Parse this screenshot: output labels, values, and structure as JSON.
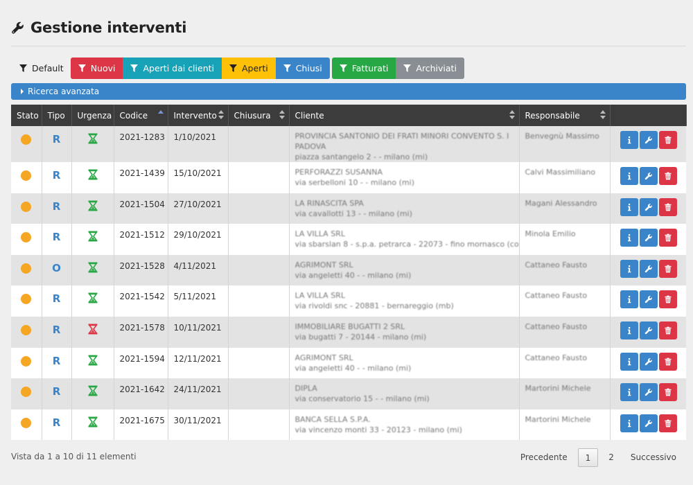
{
  "title": "Gestione interventi",
  "filters": {
    "default": "Default",
    "nuovi": "Nuovi",
    "aperti_clienti": "Aperti dai clienti",
    "aperti": "Aperti",
    "chiusi": "Chiusi",
    "fatturati": "Fatturati",
    "archiviati": "Archiviati"
  },
  "advanced_search": "Ricerca avanzata",
  "columns": {
    "stato": "Stato",
    "tipo": "Tipo",
    "urgenza": "Urgenza",
    "codice": "Codice",
    "intervento": "Intervento",
    "chiusura": "Chiusura",
    "cliente": "Cliente",
    "responsabile": "Responsabile"
  },
  "rows": [
    {
      "tipo": "R",
      "urgenza": "normal",
      "codice": "2021-1283",
      "intervento": "1/10/2021",
      "chiusura": "",
      "cliente": "PROVINCIA SANTONIO DEI FRATI MINORI CONVENTO S. I",
      "cliente2": "PADOVA",
      "indirizzo": "piazza santangelo 2 - - milano (mi)",
      "responsabile": "Benvegnù Massimo"
    },
    {
      "tipo": "R",
      "urgenza": "normal",
      "codice": "2021-1439",
      "intervento": "15/10/2021",
      "chiusura": "",
      "cliente": "PERFORAZZI SUSANNA",
      "cliente2": "",
      "indirizzo": "via serbelloni 10 - - milano (mi)",
      "responsabile": "Calvi Massimiliano"
    },
    {
      "tipo": "R",
      "urgenza": "normal",
      "codice": "2021-1504",
      "intervento": "27/10/2021",
      "chiusura": "",
      "cliente": "LA RINASCITA SPA",
      "cliente2": "",
      "indirizzo": "via cavallotti 13 - - milano (mi)",
      "responsabile": "Magani Alessandro"
    },
    {
      "tipo": "R",
      "urgenza": "normal",
      "codice": "2021-1512",
      "intervento": "29/10/2021",
      "chiusura": "",
      "cliente": "LA VILLA SRL",
      "cliente2": "",
      "indirizzo": "via sbarslan 8 - s.p.a. petrarca - 22073 - fino mornasco (co)",
      "responsabile": "Minola Emilio"
    },
    {
      "tipo": "O",
      "urgenza": "normal",
      "codice": "2021-1528",
      "intervento": "4/11/2021",
      "chiusura": "",
      "cliente": "AGRIMONT SRL",
      "cliente2": "",
      "indirizzo": "via angeletti 40 - - milano (mi)",
      "responsabile": "Cattaneo Fausto"
    },
    {
      "tipo": "R",
      "urgenza": "normal",
      "codice": "2021-1542",
      "intervento": "5/11/2021",
      "chiusura": "",
      "cliente": "LA VILLA SRL",
      "cliente2": "",
      "indirizzo": "via rivoldi snc - 20881 - bernareggio (mb)",
      "responsabile": "Cattaneo Fausto"
    },
    {
      "tipo": "R",
      "urgenza": "urgent",
      "codice": "2021-1578",
      "intervento": "10/11/2021",
      "chiusura": "",
      "cliente": "IMMOBILIARE BUGATTI 2 SRL",
      "cliente2": "",
      "indirizzo": "via bugatti 7 - 20144 - milano (mi)",
      "responsabile": "Cattaneo Fausto"
    },
    {
      "tipo": "R",
      "urgenza": "normal",
      "codice": "2021-1594",
      "intervento": "12/11/2021",
      "chiusura": "",
      "cliente": "AGRIMONT SRL",
      "cliente2": "",
      "indirizzo": "via angeletti 40 - - milano (mi)",
      "responsabile": "Cattaneo Fausto"
    },
    {
      "tipo": "R",
      "urgenza": "normal",
      "codice": "2021-1642",
      "intervento": "24/11/2021",
      "chiusura": "",
      "cliente": "DIPLA",
      "cliente2": "",
      "indirizzo": "via conservatorio 15 - - milano (mi)",
      "responsabile": "Martorini Michele"
    },
    {
      "tipo": "R",
      "urgenza": "normal",
      "codice": "2021-1675",
      "intervento": "30/11/2021",
      "chiusura": "",
      "cliente": "BANCA SELLA S.P.A.",
      "cliente2": "",
      "indirizzo": "via vincenzo monti 33 - 20123 - milano (mi)",
      "responsabile": "Martorini Michele"
    }
  ],
  "footer": {
    "info": "Vista da 1 a 10 di 11 elementi",
    "prev": "Precedente",
    "page1": "1",
    "page2": "2",
    "next": "Successivo"
  },
  "colors": {
    "stato_dot": "#f5a623",
    "urgency_normal": "#28a745",
    "urgency_urgent": "#dc3545"
  }
}
